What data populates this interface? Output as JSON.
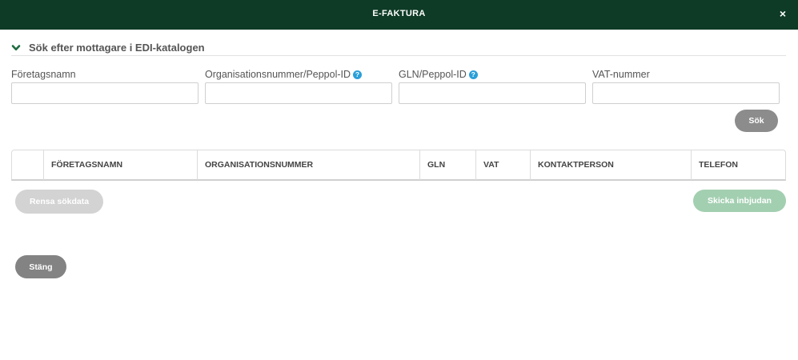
{
  "window": {
    "title": "E-FAKTURA",
    "close_label": "×"
  },
  "section": {
    "title": "Sök efter mottagare i EDI-katalogen",
    "icon": "chevron-down-icon",
    "accent_color": "#0e3b26"
  },
  "fields": {
    "company_name": {
      "label": "Företagsnamn",
      "value": ""
    },
    "org_number": {
      "label": "Organisationsnummer/Peppol-ID",
      "help": "?",
      "value": ""
    },
    "gln": {
      "label": "GLN/Peppol-ID",
      "help": "?",
      "value": ""
    },
    "vat": {
      "label": "VAT-nummer",
      "value": ""
    }
  },
  "buttons": {
    "search": "Sök",
    "clear": "Rensa sökdata",
    "invite": "Skicka inbjudan",
    "close": "Stäng"
  },
  "table": {
    "columns": [
      "FÖRETAGSNAMN",
      "ORGANISATIONSNUMMER",
      "GLN",
      "VAT",
      "KONTAKTPERSON",
      "TELEFON"
    ],
    "rows": []
  },
  "colors": {
    "header_bg": "#0e3b26",
    "help_icon": "#2a9fd8",
    "invite_disabled": "#a3cfb1"
  }
}
